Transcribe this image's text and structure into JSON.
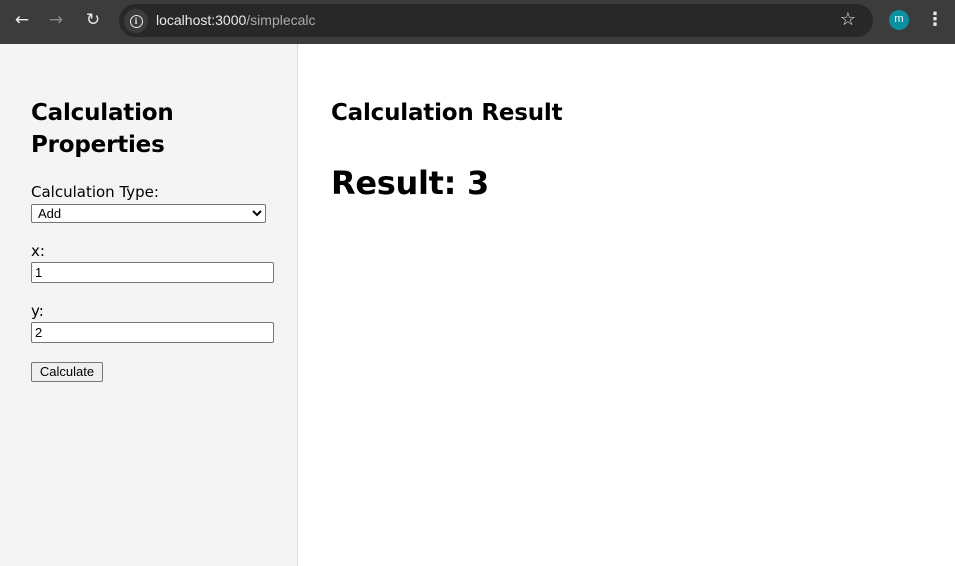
{
  "browser": {
    "back_icon": "←",
    "forward_icon": "→",
    "reload_icon": "↻",
    "url_host": "localhost:3000",
    "url_path": "/simplecalc",
    "star_icon": "☆",
    "profile_initial": "m",
    "menu_icon": "⋮",
    "accent_color": "#0a8fa3"
  },
  "sidebar": {
    "title": "Calculation Properties",
    "calc_type_label": "Calculation Type:",
    "calc_type_selected": "Add",
    "x_label": "x:",
    "x_value": "1",
    "y_label": "y:",
    "y_value": "2",
    "calculate_label": "Calculate"
  },
  "main": {
    "heading": "Calculation Result",
    "result_text": "Result: 3"
  }
}
